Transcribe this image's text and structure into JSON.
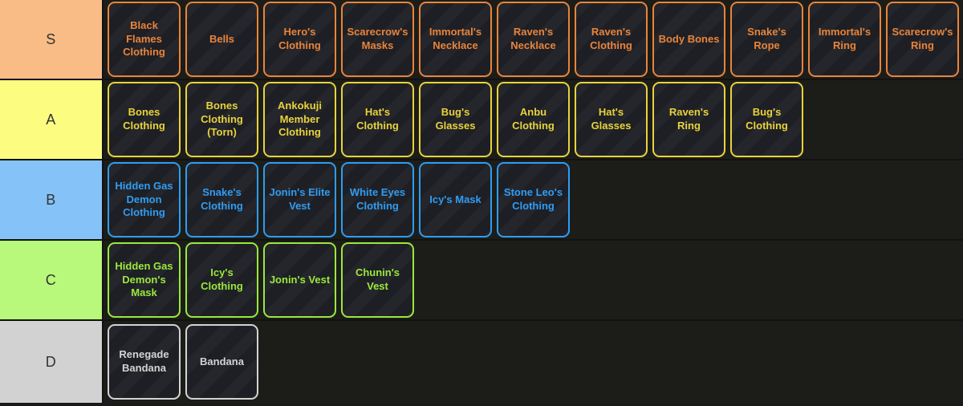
{
  "page": {
    "background_color": "#1a1a18",
    "row_background_color": "#1c1d19",
    "card_background_color": "#1e1f24",
    "divider_color": "#121212",
    "label_text_color": "#333333"
  },
  "tiers": [
    {
      "label": "S",
      "label_bg": "#f9bc86",
      "accent": "#e8843c",
      "items": [
        "Black Flames Clothing",
        "Bells",
        "Hero's Clothing",
        "Scarecrow's Masks",
        "Immortal's Necklace",
        "Raven's Necklace",
        "Raven's Clothing",
        "Body Bones",
        "Snake's Rope",
        "Immortal's Ring",
        "Scarecrow's Ring"
      ]
    },
    {
      "label": "A",
      "label_bg": "#fcfc80",
      "accent": "#e8d33c",
      "items": [
        "Bones Clothing",
        "Bones Clothing (Torn)",
        "Ankokuji Member Clothing",
        "Hat's Clothing",
        "Bug's Glasses",
        "Anbu Clothing",
        "Hat's Glasses",
        "Raven's Ring",
        "Bug's Clothing"
      ]
    },
    {
      "label": "B",
      "label_bg": "#85c2f8",
      "accent": "#2e9df4",
      "items": [
        "Hidden Gas Demon Clothing",
        "Snake's Clothing",
        "Jonin's Elite Vest",
        "White Eyes Clothing",
        "Icy's Mask",
        "Stone Leo's Clothing"
      ]
    },
    {
      "label": "C",
      "label_bg": "#b8f87a",
      "accent": "#9ae83c",
      "items": [
        "Hidden Gas Demon's Mask",
        "Icy's Clothing",
        "Jonin's Vest",
        "Chunin's Vest"
      ]
    },
    {
      "label": "D",
      "label_bg": "#d2d2d2",
      "accent": "#d3d3d3",
      "items": [
        "Renegade Bandana",
        "Bandana"
      ]
    }
  ]
}
